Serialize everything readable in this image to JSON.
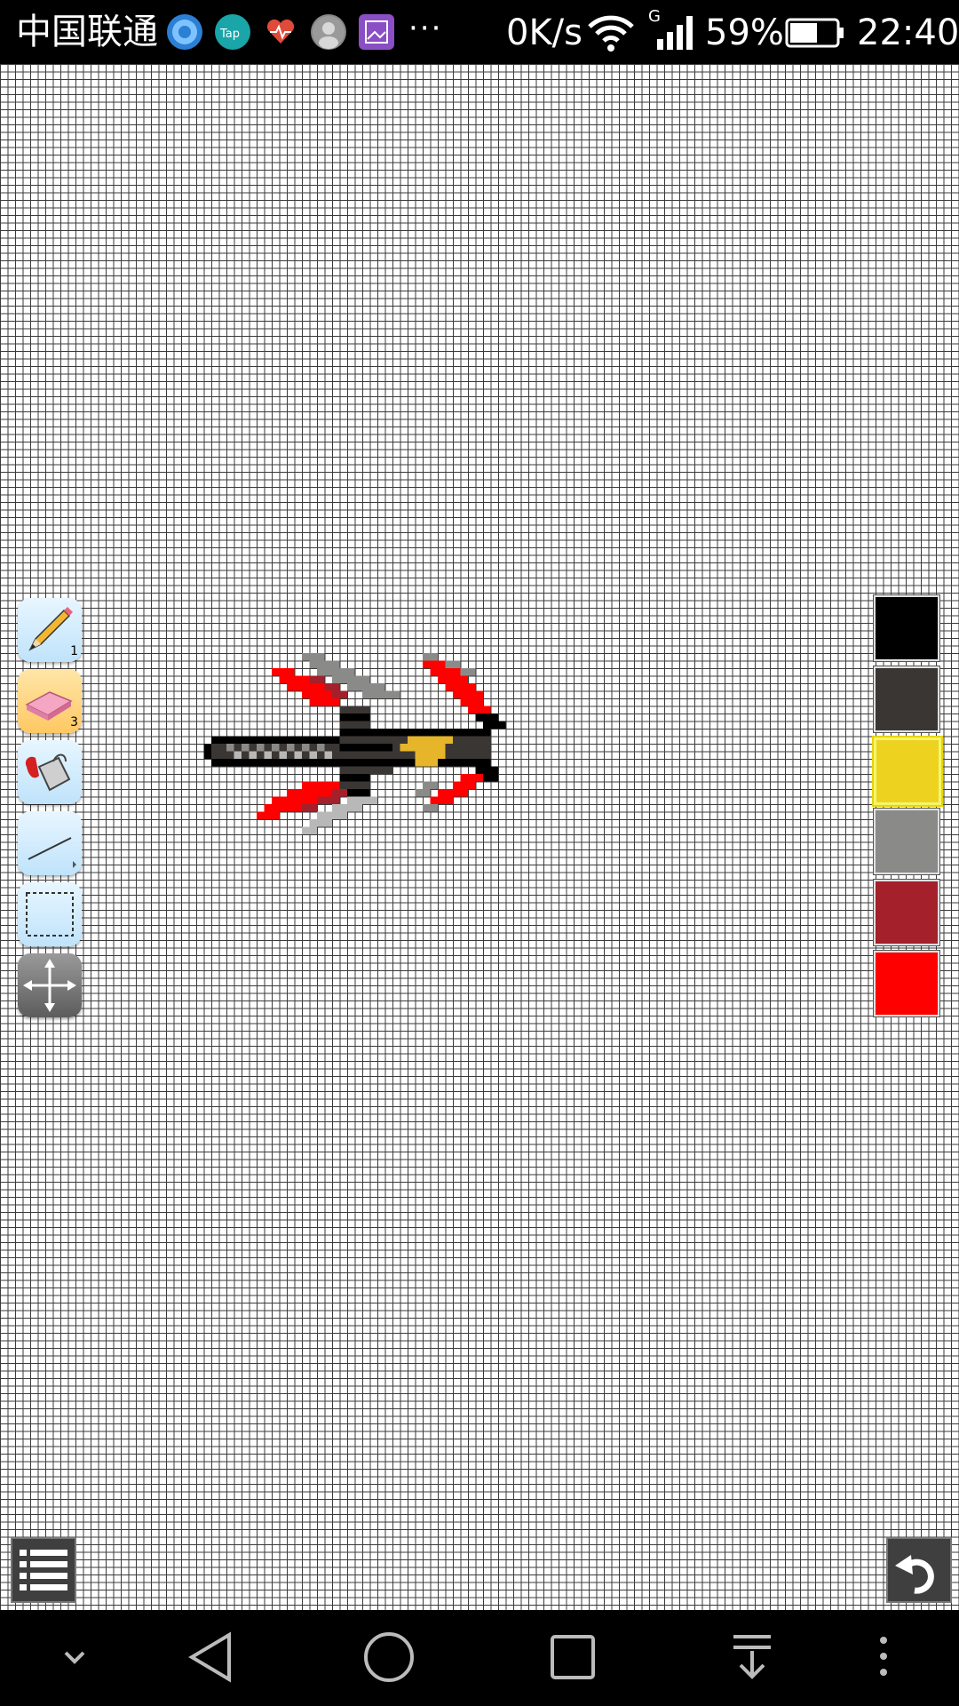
{
  "status_bar": {
    "carrier": "中国联通",
    "more": "···",
    "net_speed": "0K/s",
    "signal_type": "G",
    "battery_percent": "59%",
    "time": "22:40"
  },
  "notification_icons": [
    "q-browser-icon",
    "taptap-icon",
    "health-icon",
    "avatar-icon",
    "gallery-icon"
  ],
  "tools": [
    {
      "name": "pencil-tool",
      "badge": "1",
      "active": false
    },
    {
      "name": "eraser-tool",
      "badge": "3",
      "active": true
    },
    {
      "name": "fill-bucket-tool",
      "badge": "",
      "active": false
    },
    {
      "name": "line-tool",
      "badge": "",
      "active": false
    },
    {
      "name": "selection-tool",
      "badge": "",
      "active": false
    },
    {
      "name": "move-tool",
      "badge": "",
      "active": false
    }
  ],
  "palette": [
    {
      "name": "black",
      "color": "#000000",
      "selected": false
    },
    {
      "name": "dark-gray",
      "color": "#3a3634",
      "selected": false
    },
    {
      "name": "yellow",
      "color": "#eed220",
      "selected": true
    },
    {
      "name": "gray",
      "color": "#8a8b89",
      "selected": false
    },
    {
      "name": "dark-red",
      "color": "#a4202a",
      "selected": false
    },
    {
      "name": "red",
      "color": "#ff0000",
      "selected": false
    }
  ],
  "canvas": {
    "grid_cell_note": "pixel grid",
    "artwork": "pixel sword"
  }
}
